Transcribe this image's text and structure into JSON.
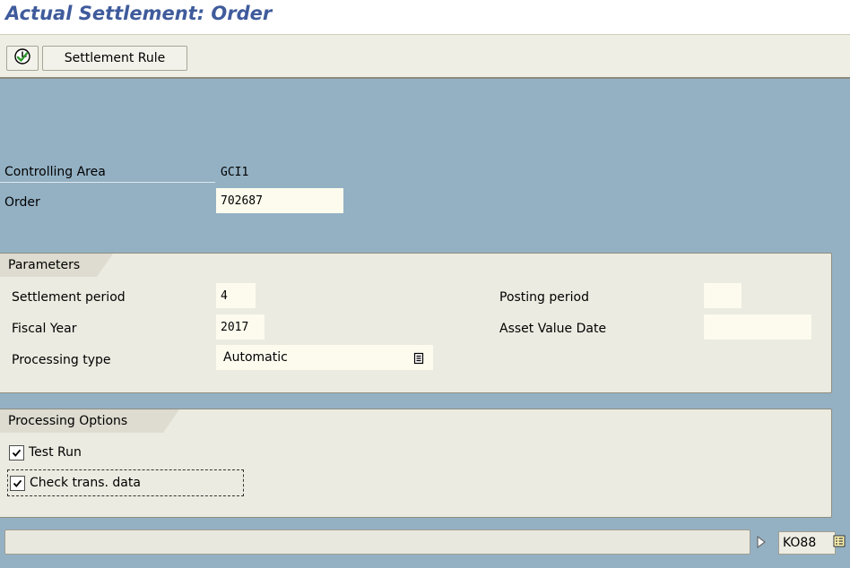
{
  "window": {
    "title": "Actual Settlement: Order"
  },
  "toolbar": {
    "execute_icon": "execute-clock-icon",
    "settlement_rule_label": "Settlement Rule"
  },
  "header_fields": {
    "controlling_area": {
      "label": "Controlling Area",
      "value": "GCI1"
    },
    "order": {
      "label": "Order",
      "value": "702687"
    }
  },
  "parameters": {
    "title": "Parameters",
    "settlement_period": {
      "label": "Settlement period",
      "value": "4"
    },
    "fiscal_year": {
      "label": "Fiscal Year",
      "value": "2017"
    },
    "processing_type": {
      "label": "Processing type",
      "value": "Automatic",
      "icon": "dropdown-list-icon"
    },
    "posting_period": {
      "label": "Posting period",
      "value": ""
    },
    "asset_value_date": {
      "label": "Asset Value Date",
      "value": ""
    }
  },
  "processing_options": {
    "title": "Processing Options",
    "test_run": {
      "label": "Test Run",
      "checked": true
    },
    "check_trans_data": {
      "label": "Check trans. data",
      "checked": true
    }
  },
  "status_bar": {
    "transaction_code": "KO88",
    "expand_icon": "triangle-right-icon",
    "menu_icon": "list-menu-icon"
  },
  "colors": {
    "background": "#94b1c4",
    "title": "#3f5b9c",
    "toolbar": "#efeee4",
    "group": "#ecebe1",
    "input": "#fdfbee"
  }
}
